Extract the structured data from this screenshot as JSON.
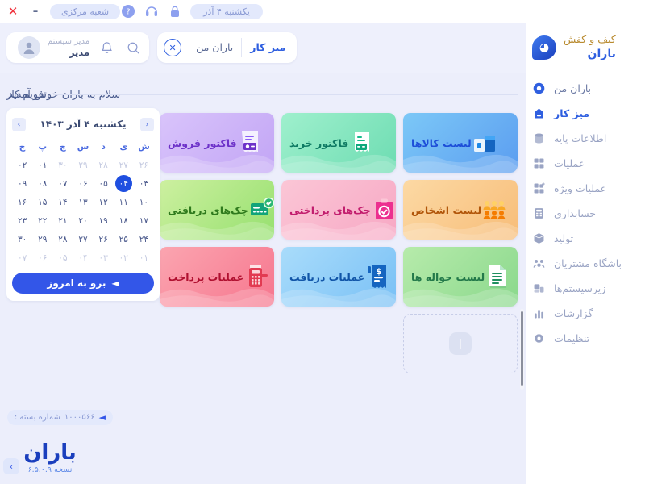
{
  "titlebar": {
    "date_pill": "یکشنبه ۴ آذر",
    "branch_pill": "شعبه مرکزی",
    "minimize": "–",
    "close": "✕",
    "icons": [
      "lock-icon",
      "headset-icon",
      "help-icon"
    ]
  },
  "sidebar": {
    "brand": {
      "line1": "کیف و کفش",
      "line2": "باران"
    },
    "items": [
      {
        "label": "باران من",
        "icon": "baran-drop-icon",
        "active": false
      },
      {
        "label": "میز کار",
        "icon": "desk-icon",
        "active": true
      },
      {
        "label": "اطلاعات پایه",
        "icon": "database-icon",
        "active": false
      },
      {
        "label": "عملیات",
        "icon": "grid-icon",
        "active": false
      },
      {
        "label": "عملیات ویژه",
        "icon": "grid-plus-icon",
        "active": false
      },
      {
        "label": "حسابداری",
        "icon": "calculator-icon",
        "active": false
      },
      {
        "label": "تولید",
        "icon": "box-icon",
        "active": false
      },
      {
        "label": "باشگاه مشتریان",
        "icon": "people-icon",
        "active": false
      },
      {
        "label": "زیرسیستم‌ها",
        "icon": "subsystem-icon",
        "active": false
      },
      {
        "label": "گزارشات",
        "icon": "chart-bar-icon",
        "active": false
      },
      {
        "label": "تنظیمات",
        "icon": "gear-icon",
        "active": false
      }
    ]
  },
  "topbar": {
    "user_name": "مدیر",
    "user_role": "مدیر سیستم",
    "search_icon": "search-icon",
    "bell_icon": "bell-icon",
    "tabs": [
      {
        "label": "میز کار",
        "active": true
      },
      {
        "label": "باران من",
        "active": false
      }
    ],
    "close_tab": "✕"
  },
  "welcome": {
    "text": "سلام به باران خوش آمدید"
  },
  "tiles": [
    {
      "label": "لیست کالاها",
      "icon": "boxes-icon",
      "bg1": "#7cc8f7",
      "bg2": "#5b9df0",
      "text": "#1d4ed8"
    },
    {
      "label": "فاکتور خرید",
      "icon": "receipt-icon",
      "bg1": "#9ff0cd",
      "bg2": "#6ddcb2",
      "text": "#0e7a63"
    },
    {
      "label": "فاکتور فروش",
      "icon": "invoice-icon",
      "bg1": "#d9c4fb",
      "bg2": "#c2a5f5",
      "text": "#6d32c9"
    },
    {
      "label": "لیست اشخاص",
      "icon": "persons-icon",
      "bg1": "#fcd9a4",
      "bg2": "#f7bd79",
      "text": "#b1560a"
    },
    {
      "label": "چک‌های پرداختی",
      "icon": "check-pay-icon",
      "bg1": "#fbc6d6",
      "bg2": "#f7a8c4",
      "text": "#c21d6e"
    },
    {
      "label": "چک‌های دریافتی",
      "icon": "check-recv-icon",
      "bg1": "#cdf0a0",
      "bg2": "#96e06f",
      "text": "#2f7a1d"
    },
    {
      "label": "لیست حواله ها",
      "icon": "document-icon",
      "bg1": "#b7ebab",
      "bg2": "#8ad88c",
      "text": "#23794a"
    },
    {
      "label": "عملیات دریافت",
      "icon": "receive-icon",
      "bg1": "#a9dcfb",
      "bg2": "#79c0f5",
      "text": "#1155a8"
    },
    {
      "label": "عملیات پرداخت",
      "icon": "pos-icon",
      "bg1": "#fba5b0",
      "bg2": "#f6768e",
      "text": "#b01030"
    }
  ],
  "add_tile": {
    "icon": "plus-icon",
    "label": "+"
  },
  "calendar": {
    "section_title": "تقویم کار",
    "month_title": "یکشنبه ۴ آذر ۱۴۰۳",
    "prev": "‹",
    "next": "›",
    "dow": [
      "ش",
      "ی",
      "د",
      "س",
      "چ",
      "پ",
      "ج"
    ],
    "weeks": [
      [
        {
          "d": "۲۶",
          "s": "mut"
        },
        {
          "d": "۲۷",
          "s": "mut"
        },
        {
          "d": "۲۸",
          "s": "mut"
        },
        {
          "d": "۲۹",
          "s": "mut"
        },
        {
          "d": "۳۰",
          "s": "mut"
        },
        {
          "d": "۰۱",
          "s": ""
        },
        {
          "d": "۰۲",
          "s": ""
        }
      ],
      [
        {
          "d": "۰۳",
          "s": ""
        },
        {
          "d": "۰۴",
          "s": "sel"
        },
        {
          "d": "۰۵",
          "s": ""
        },
        {
          "d": "۰۶",
          "s": ""
        },
        {
          "d": "۰۷",
          "s": ""
        },
        {
          "d": "۰۸",
          "s": ""
        },
        {
          "d": "۰۹",
          "s": ""
        }
      ],
      [
        {
          "d": "۱۰",
          "s": ""
        },
        {
          "d": "۱۱",
          "s": ""
        },
        {
          "d": "۱۲",
          "s": ""
        },
        {
          "d": "۱۳",
          "s": ""
        },
        {
          "d": "۱۴",
          "s": ""
        },
        {
          "d": "۱۵",
          "s": ""
        },
        {
          "d": "۱۶",
          "s": ""
        }
      ],
      [
        {
          "d": "۱۷",
          "s": ""
        },
        {
          "d": "۱۸",
          "s": ""
        },
        {
          "d": "۱۹",
          "s": ""
        },
        {
          "d": "۲۰",
          "s": ""
        },
        {
          "d": "۲۱",
          "s": ""
        },
        {
          "d": "۲۲",
          "s": ""
        },
        {
          "d": "۲۳",
          "s": ""
        }
      ],
      [
        {
          "d": "۲۴",
          "s": ""
        },
        {
          "d": "۲۵",
          "s": ""
        },
        {
          "d": "۲۶",
          "s": ""
        },
        {
          "d": "۲۷",
          "s": ""
        },
        {
          "d": "۲۸",
          "s": ""
        },
        {
          "d": "۲۹",
          "s": ""
        },
        {
          "d": "۳۰",
          "s": ""
        }
      ],
      [
        {
          "d": "۰۱",
          "s": "mut"
        },
        {
          "d": "۰۲",
          "s": "mut"
        },
        {
          "d": "۰۳",
          "s": "mut"
        },
        {
          "d": "۰۴",
          "s": "mut"
        },
        {
          "d": "۰۵",
          "s": "mut"
        },
        {
          "d": "۰۶",
          "s": "mut"
        },
        {
          "d": "۰۷",
          "s": "mut"
        }
      ]
    ],
    "today_button": "برو به امروز",
    "today_arrow": "◄"
  },
  "footer": {
    "package_label": "شماره بسته :",
    "package_number": "۱۰۰۰۵۶۶",
    "package_arrow": "◄",
    "logo_text": "باران",
    "version": "نسخه ۶.۵.۰.۹",
    "collapse_icon": "chevron-right-icon"
  },
  "colors": {
    "page_bg": "#eceefb",
    "panel_bg": "#ffffff",
    "accent": "#3356e8",
    "muted_text": "#9aa4c4",
    "gold": "#b88a2e",
    "danger": "#f0323c"
  }
}
